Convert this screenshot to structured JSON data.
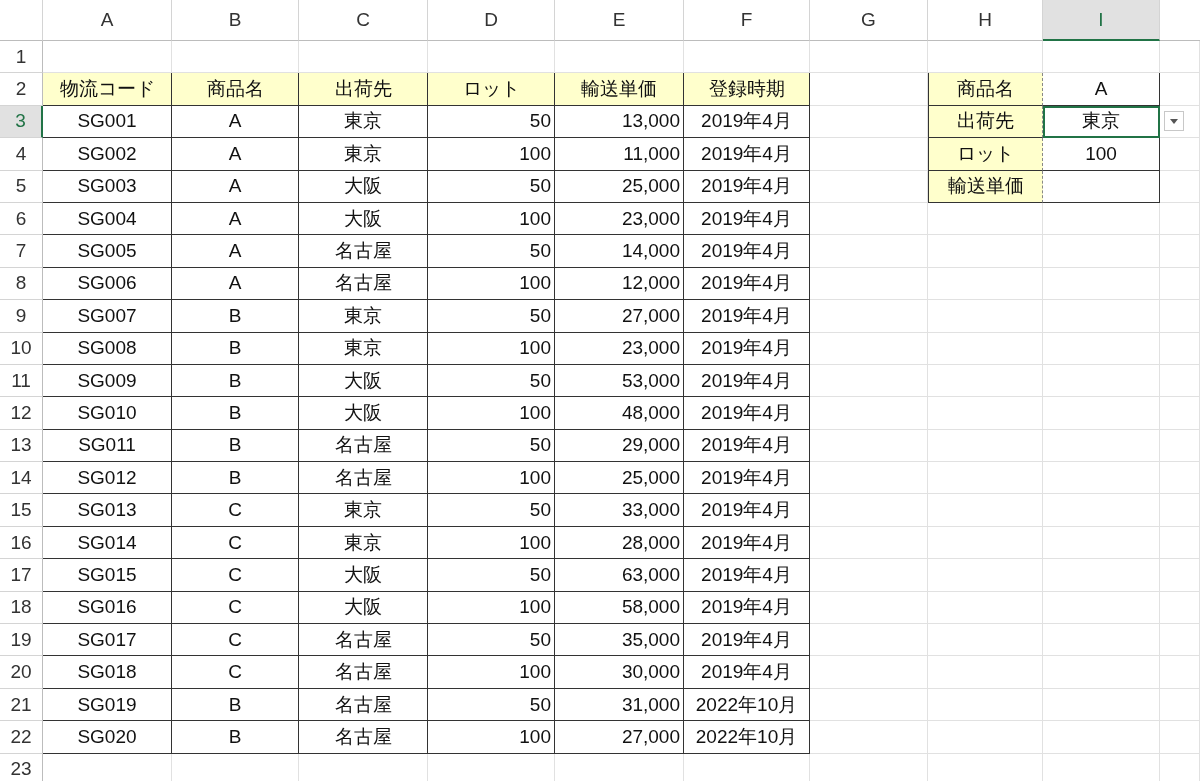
{
  "column_headers": [
    {
      "label": "A",
      "selected": false
    },
    {
      "label": "B",
      "selected": false
    },
    {
      "label": "C",
      "selected": false
    },
    {
      "label": "D",
      "selected": false
    },
    {
      "label": "E",
      "selected": false
    },
    {
      "label": "F",
      "selected": false
    },
    {
      "label": "G",
      "selected": false
    },
    {
      "label": "H",
      "selected": false
    },
    {
      "label": "I",
      "selected": true
    }
  ],
  "row_headers": [
    {
      "label": "1",
      "selected": false
    },
    {
      "label": "2",
      "selected": false
    },
    {
      "label": "3",
      "selected": true
    },
    {
      "label": "4",
      "selected": false
    },
    {
      "label": "5",
      "selected": false
    },
    {
      "label": "6",
      "selected": false
    },
    {
      "label": "7",
      "selected": false
    },
    {
      "label": "8",
      "selected": false
    },
    {
      "label": "9",
      "selected": false
    },
    {
      "label": "10",
      "selected": false
    },
    {
      "label": "11",
      "selected": false
    },
    {
      "label": "12",
      "selected": false
    },
    {
      "label": "13",
      "selected": false
    },
    {
      "label": "14",
      "selected": false
    },
    {
      "label": "15",
      "selected": false
    },
    {
      "label": "16",
      "selected": false
    },
    {
      "label": "17",
      "selected": false
    },
    {
      "label": "18",
      "selected": false
    },
    {
      "label": "19",
      "selected": false
    },
    {
      "label": "20",
      "selected": false
    },
    {
      "label": "21",
      "selected": false
    },
    {
      "label": "22",
      "selected": false
    },
    {
      "label": "23",
      "selected": false
    }
  ],
  "table": {
    "columns": [
      "物流コード",
      "商品名",
      "出荷先",
      "ロット",
      "輸送単価",
      "登録時期"
    ],
    "rows": [
      [
        "SG001",
        "A",
        "東京",
        "50",
        "13,000",
        "2019年4月"
      ],
      [
        "SG002",
        "A",
        "東京",
        "100",
        "11,000",
        "2019年4月"
      ],
      [
        "SG003",
        "A",
        "大阪",
        "50",
        "25,000",
        "2019年4月"
      ],
      [
        "SG004",
        "A",
        "大阪",
        "100",
        "23,000",
        "2019年4月"
      ],
      [
        "SG005",
        "A",
        "名古屋",
        "50",
        "14,000",
        "2019年4月"
      ],
      [
        "SG006",
        "A",
        "名古屋",
        "100",
        "12,000",
        "2019年4月"
      ],
      [
        "SG007",
        "B",
        "東京",
        "50",
        "27,000",
        "2019年4月"
      ],
      [
        "SG008",
        "B",
        "東京",
        "100",
        "23,000",
        "2019年4月"
      ],
      [
        "SG009",
        "B",
        "大阪",
        "50",
        "53,000",
        "2019年4月"
      ],
      [
        "SG010",
        "B",
        "大阪",
        "100",
        "48,000",
        "2019年4月"
      ],
      [
        "SG011",
        "B",
        "名古屋",
        "50",
        "29,000",
        "2019年4月"
      ],
      [
        "SG012",
        "B",
        "名古屋",
        "100",
        "25,000",
        "2019年4月"
      ],
      [
        "SG013",
        "C",
        "東京",
        "50",
        "33,000",
        "2019年4月"
      ],
      [
        "SG014",
        "C",
        "東京",
        "100",
        "28,000",
        "2019年4月"
      ],
      [
        "SG015",
        "C",
        "大阪",
        "50",
        "63,000",
        "2019年4月"
      ],
      [
        "SG016",
        "C",
        "大阪",
        "100",
        "58,000",
        "2019年4月"
      ],
      [
        "SG017",
        "C",
        "名古屋",
        "50",
        "35,000",
        "2019年4月"
      ],
      [
        "SG018",
        "C",
        "名古屋",
        "100",
        "30,000",
        "2019年4月"
      ],
      [
        "SG019",
        "B",
        "名古屋",
        "50",
        "31,000",
        "2022年10月"
      ],
      [
        "SG020",
        "B",
        "名古屋",
        "100",
        "27,000",
        "2022年10月"
      ]
    ]
  },
  "lookup": {
    "rows": [
      {
        "label": "商品名",
        "value": "A",
        "selected": false,
        "dropdown": false
      },
      {
        "label": "出荷先",
        "value": "東京",
        "selected": true,
        "dropdown": true
      },
      {
        "label": "ロット",
        "value": "100",
        "selected": false,
        "dropdown": false
      },
      {
        "label": "輸送単価",
        "selected": false,
        "dropdown": false
      }
    ]
  }
}
